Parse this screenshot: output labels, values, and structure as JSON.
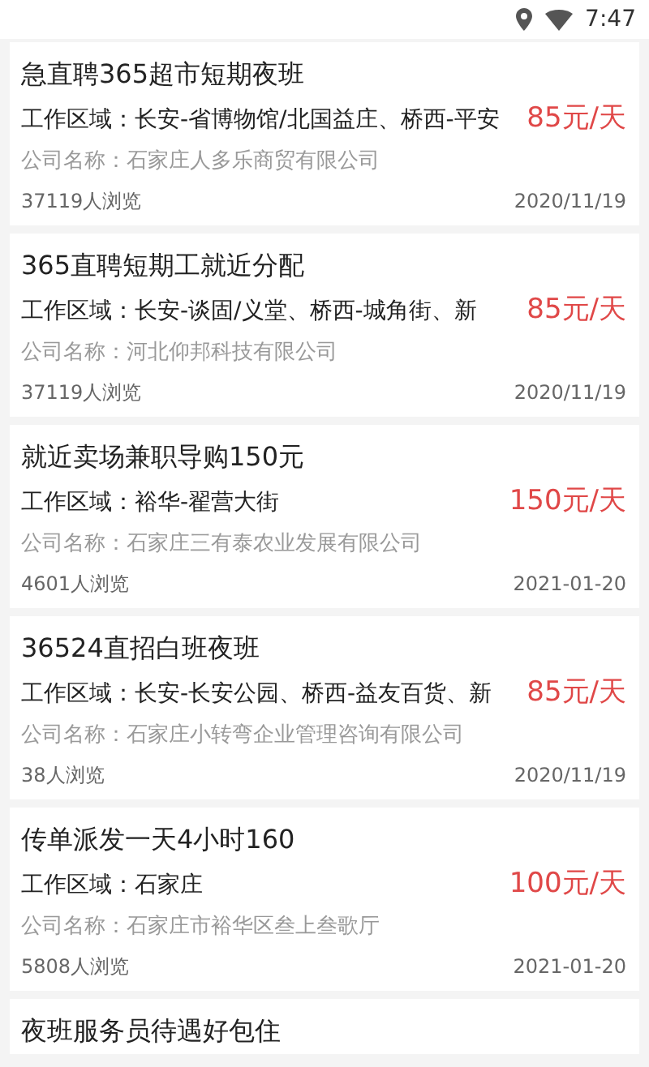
{
  "status_bar": {
    "time": "7:47"
  },
  "jobs": [
    {
      "title": "急直聘365超市短期夜班",
      "area_label": "工作区域：",
      "area": "长安-省博物馆/北国益庄、桥西-平安",
      "pay": "85元/天",
      "company": "公司名称：石家庄人多乐商贸有限公司",
      "views": "37119人浏览",
      "date": "2020/11/19"
    },
    {
      "title": "365直聘短期工就近分配",
      "area_label": "工作区域：",
      "area": "长安-谈固/义堂、桥西-城角街、新",
      "pay": "85元/天",
      "company": "公司名称：河北仰邦科技有限公司",
      "views": "37119人浏览",
      "date": "2020/11/19"
    },
    {
      "title": "就近卖场兼职导购150元",
      "area_label": "工作区域：",
      "area": "裕华-翟营大街",
      "pay": "150元/天",
      "company": "公司名称：石家庄三有泰农业发展有限公司",
      "views": "4601人浏览",
      "date": "2021-01-20"
    },
    {
      "title": "36524直招白班夜班",
      "area_label": "工作区域：",
      "area": "长安-长安公园、桥西-益友百货、新",
      "pay": "85元/天",
      "company": "公司名称：石家庄小转弯企业管理咨询有限公司",
      "views": "38人浏览",
      "date": "2020/11/19"
    },
    {
      "title": "传单派发一天4小时160",
      "area_label": "工作区域：",
      "area": "石家庄",
      "pay": "100元/天",
      "company": "公司名称：石家庄市裕华区叁上叁歌厅",
      "views": "5808人浏览",
      "date": "2021-01-20"
    },
    {
      "title": "夜班服务员待遇好包住"
    }
  ]
}
